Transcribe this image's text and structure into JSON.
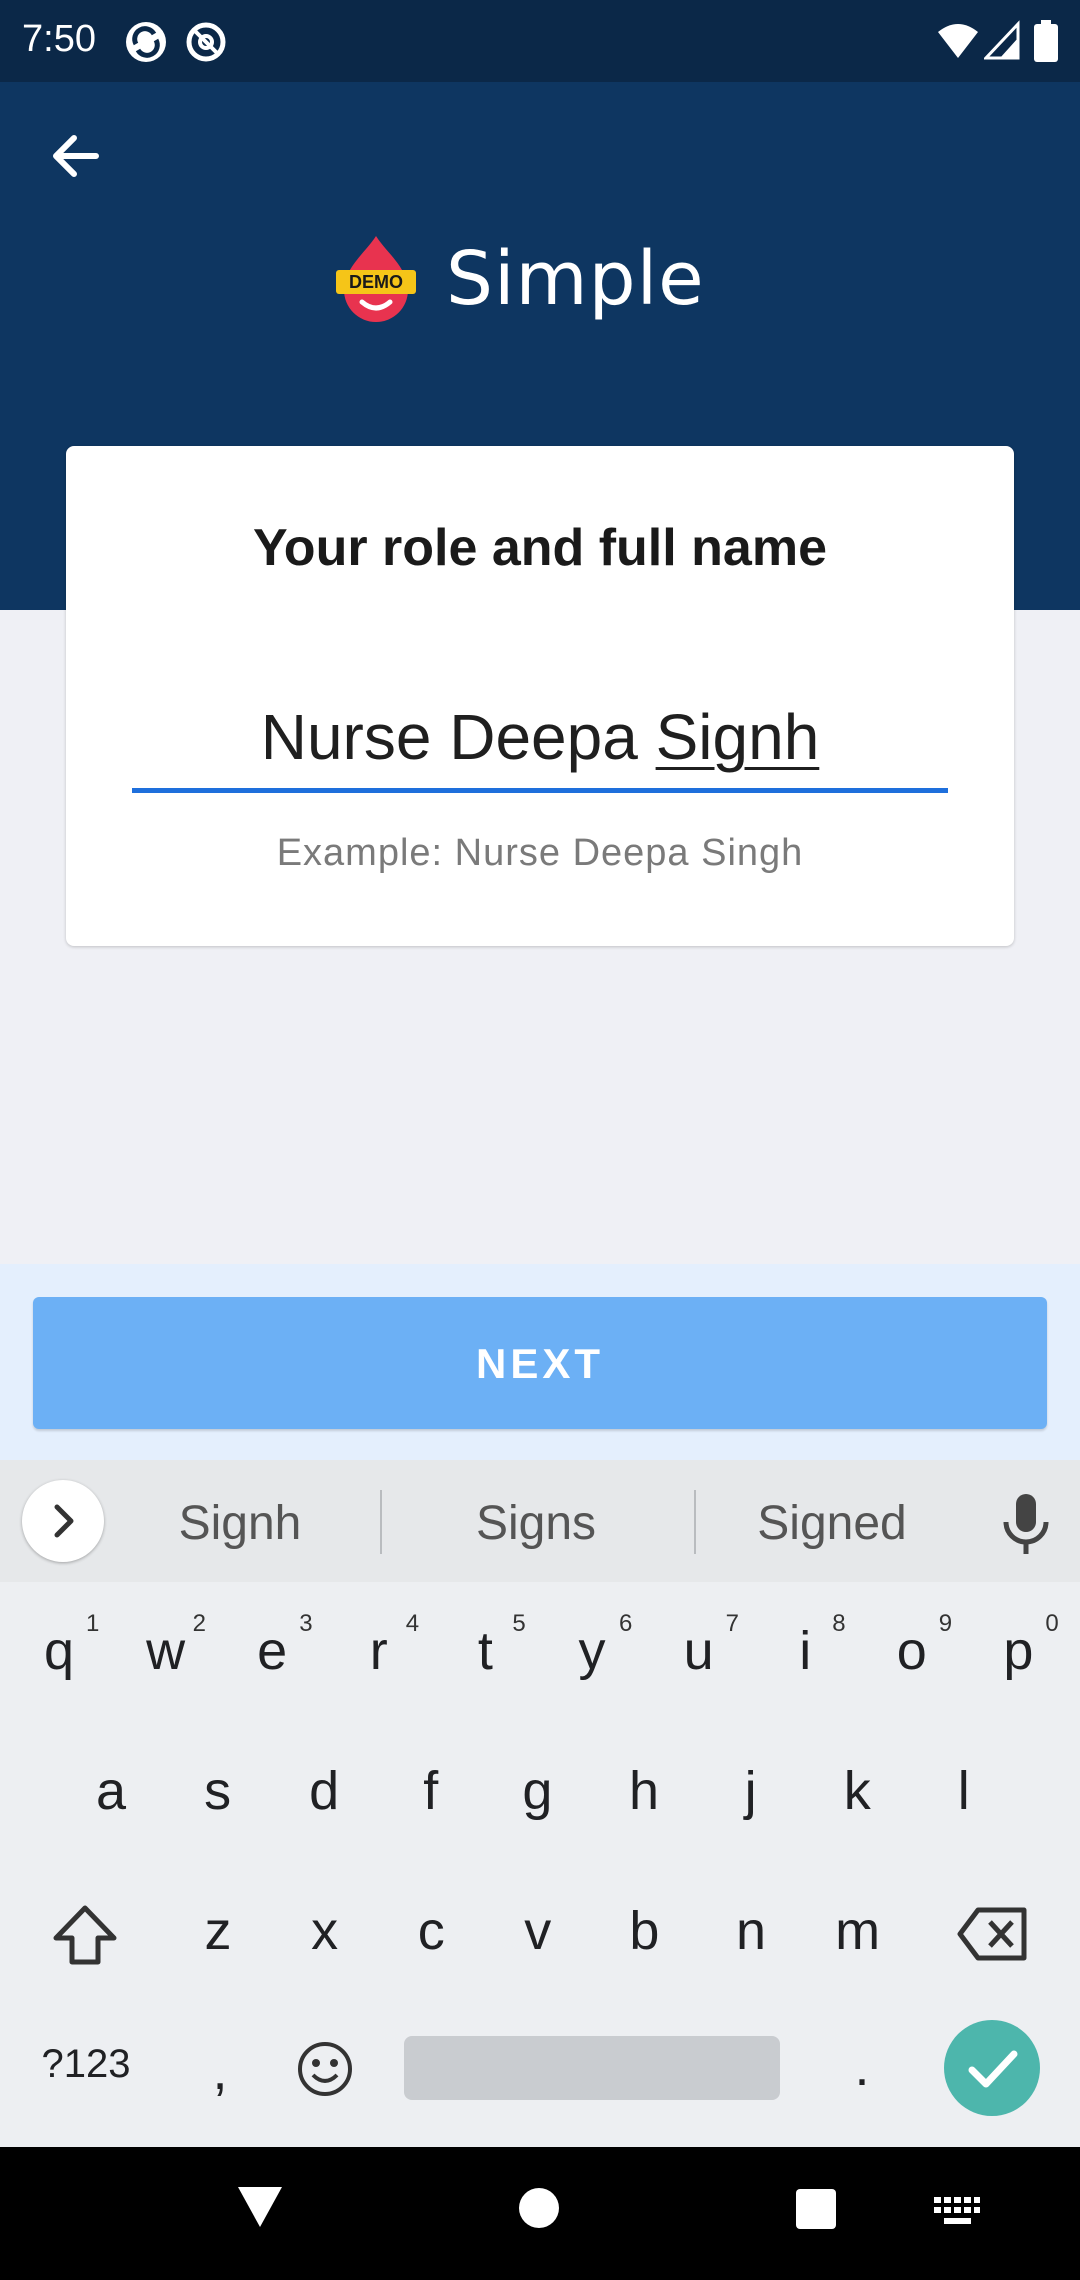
{
  "status_bar": {
    "time": "7:50",
    "icons": [
      "sync-icon",
      "at-icon",
      "wifi-icon",
      "signal-icon",
      "battery-icon"
    ]
  },
  "header": {
    "back_icon": "arrow-back-icon",
    "logo_badge": "DEMO",
    "app_name": "Simple"
  },
  "card": {
    "title": "Your role and full name",
    "input_text_prefix": "Nurse Deepa ",
    "input_text_composing": "Signh",
    "hint": "Example: Nurse Deepa Singh"
  },
  "next_button": {
    "label": "NEXT"
  },
  "keyboard": {
    "suggestions": [
      "Signh",
      "Signs",
      "Signed"
    ],
    "row1": [
      {
        "key": "q",
        "num": "1"
      },
      {
        "key": "w",
        "num": "2"
      },
      {
        "key": "e",
        "num": "3"
      },
      {
        "key": "r",
        "num": "4"
      },
      {
        "key": "t",
        "num": "5"
      },
      {
        "key": "y",
        "num": "6"
      },
      {
        "key": "u",
        "num": "7"
      },
      {
        "key": "i",
        "num": "8"
      },
      {
        "key": "o",
        "num": "9"
      },
      {
        "key": "p",
        "num": "0"
      }
    ],
    "row2": [
      "a",
      "s",
      "d",
      "f",
      "g",
      "h",
      "j",
      "k",
      "l"
    ],
    "row3": [
      "z",
      "x",
      "c",
      "v",
      "b",
      "n",
      "m"
    ],
    "symbols_key": "?123",
    "comma_key": ",",
    "period_key": "."
  },
  "colors": {
    "header_bg": "#0e3661",
    "status_bg": "#0b2848",
    "accent_blue": "#1e6fdc",
    "next_button": "#6cb0f5",
    "enter_key": "#4db6ac"
  }
}
